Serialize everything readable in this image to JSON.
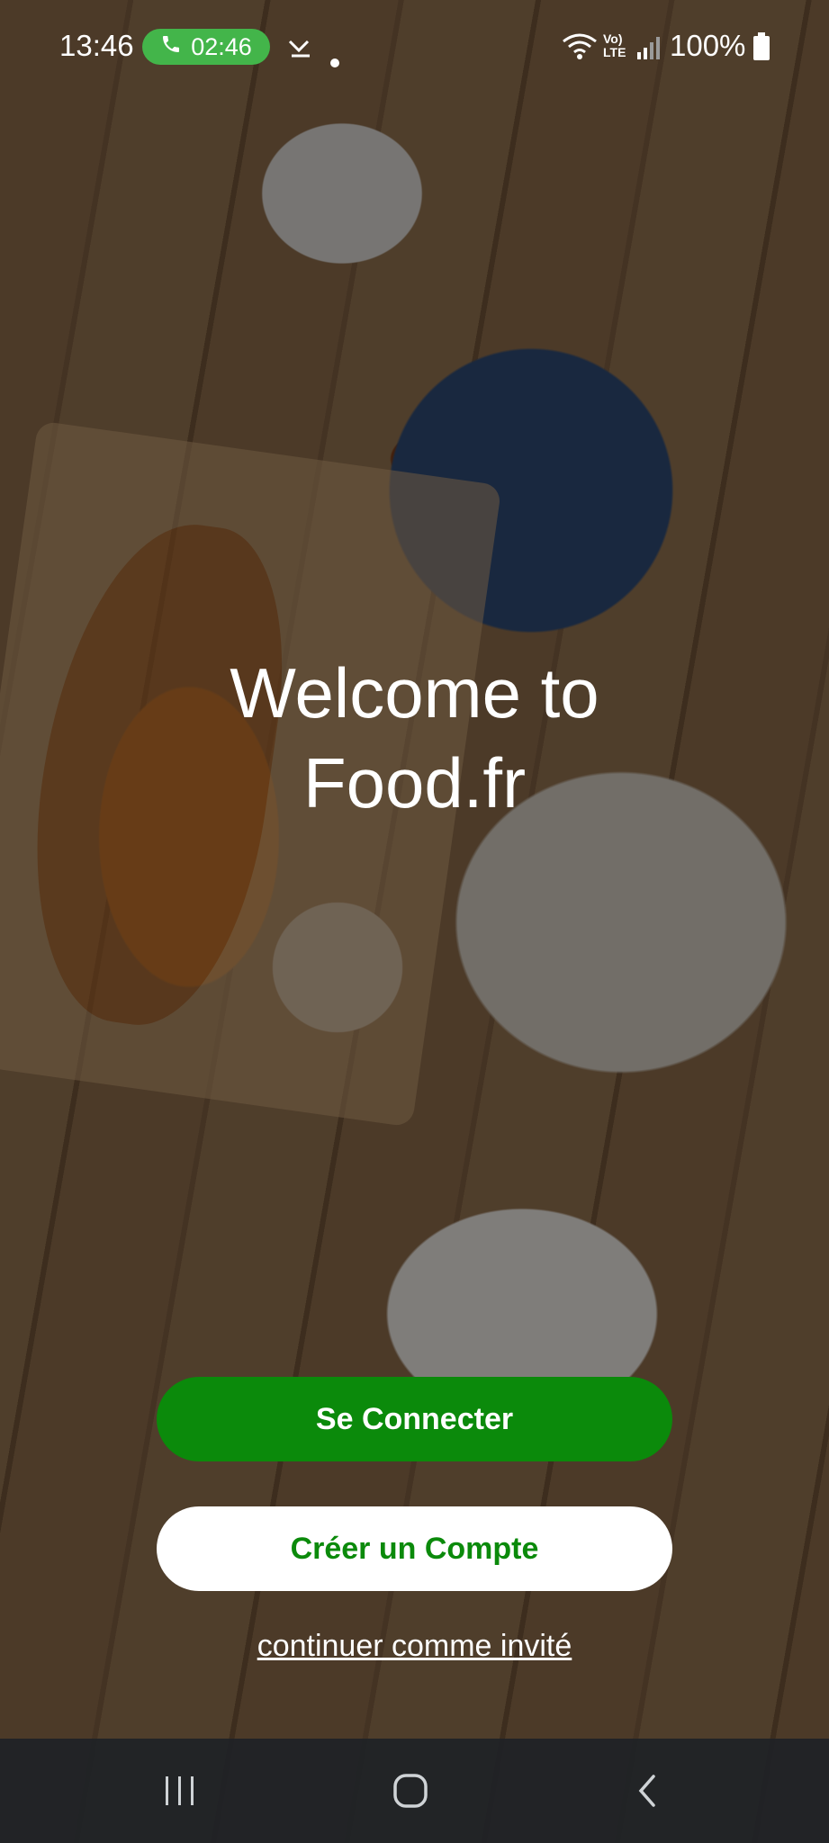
{
  "status_bar": {
    "time": "13:46",
    "call_timer": "02:46",
    "call_icon": "phone-icon",
    "battery_percent": "100%",
    "icons": [
      "missed-call-icon",
      "dot-icon",
      "wifi-icon",
      "volte-icon",
      "signal-icon",
      "battery-icon"
    ],
    "call_pill_color": "#43b54a"
  },
  "welcome": {
    "line1": "Welcome to",
    "line2": "Food.fr"
  },
  "actions": {
    "login_label": "Se Connecter",
    "create_account_label": "Créer un Compte",
    "guest_label": "continuer comme invité",
    "primary_color": "#0b8a0b"
  },
  "nav_bar": {
    "icons": [
      "recent-apps-icon",
      "home-icon",
      "back-icon"
    ]
  }
}
